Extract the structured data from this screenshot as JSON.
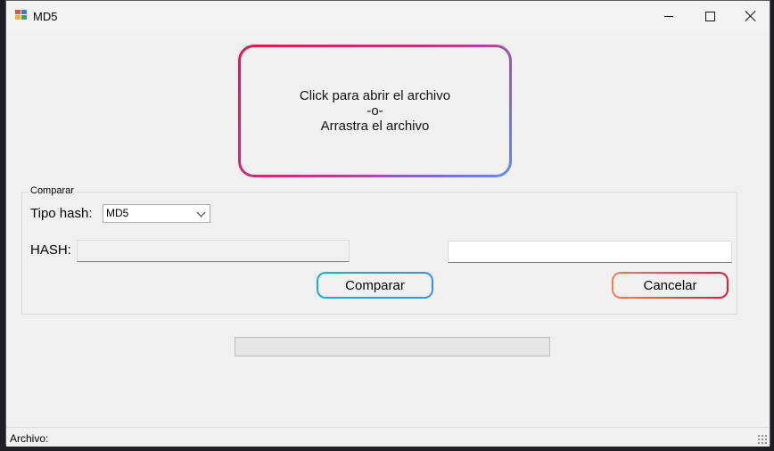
{
  "window": {
    "title": "MD5",
    "icon": "app-window-icon",
    "controls": [
      "minimize-icon",
      "maximize-icon",
      "close-icon"
    ]
  },
  "dropzone": {
    "line1": "Click para abrir el archivo",
    "line2": "-o-",
    "line3": "Arrastra el archivo",
    "border_colors": [
      "#e0184f",
      "#5f8fea"
    ]
  },
  "compare": {
    "group_title": "Comparar",
    "hash_type_label": "Tipo hash:",
    "hash_type_value": "MD5",
    "hash_label": "HASH:",
    "hash_value": "",
    "compare_hash_value": "",
    "compare_button": "Comparar",
    "cancel_button": "Cancelar",
    "compare_button_colors": [
      "#18b0d2",
      "#3d8fe0"
    ],
    "cancel_button_colors": [
      "#f0805a",
      "#e0183f"
    ]
  },
  "progress": {
    "value": 0
  },
  "status": {
    "text": "Archivo:"
  }
}
